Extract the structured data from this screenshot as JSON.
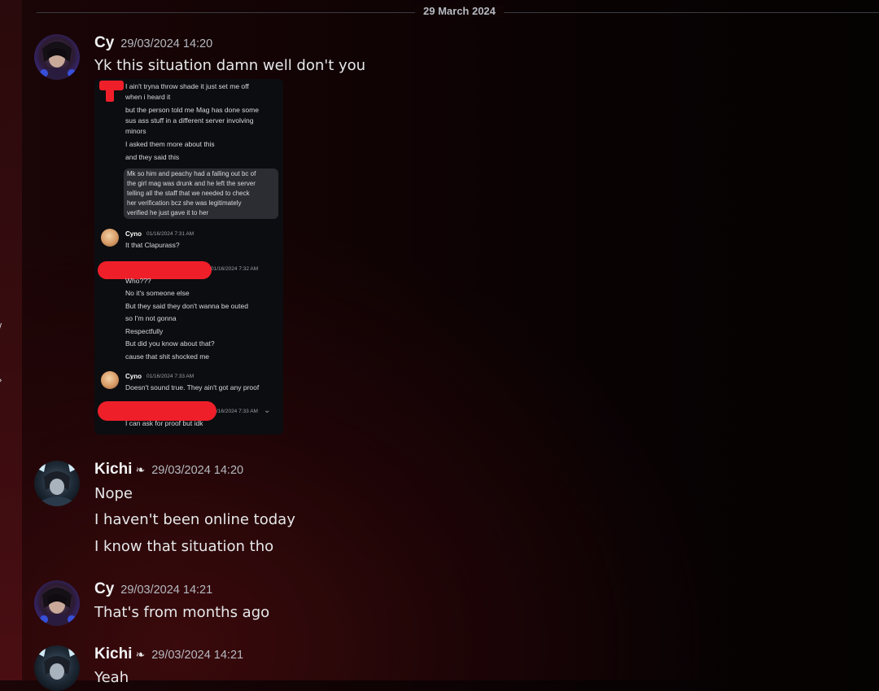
{
  "divider_date": "29 March 2024",
  "messages": [
    {
      "author": "Cy",
      "timestamp": "29/03/2024 14:20",
      "lines": [
        "Yk this situation damn well don't you"
      ]
    },
    {
      "author": "Kichi",
      "author_emoji": "❧",
      "timestamp": "29/03/2024 14:20",
      "lines": [
        "Nope",
        "I haven't been online today",
        "I know that situation tho"
      ]
    },
    {
      "author": "Cy",
      "timestamp": "29/03/2024 14:21",
      "lines": [
        "That's from months ago"
      ]
    },
    {
      "author": "Kichi",
      "author_emoji": "❧",
      "timestamp": "29/03/2024 14:21",
      "lines": [
        "Yeah"
      ]
    }
  ],
  "attachment": {
    "lines_top": [
      "I ain't tryna throw shade it just set me off",
      "when i heard it",
      "but the person told me Mag has done some",
      "sus ass stuff in a different server involving",
      "minors",
      "I asked them more about this",
      "and they said this"
    ],
    "quote_lines": [
      "Mk so him and peachy had a falling out bc of",
      "the girl mag was drunk and he left the server",
      "telling all the staff that we needed to check",
      "her verification bcz she was legitimately",
      "verified he just gave it to her"
    ],
    "cyno_name_1": "Cyno",
    "cyno_time_1": "01/16/2024 7:31 AM",
    "cyno_msg_1": "It that Clapurass?",
    "redacted_time_1": "01/16/2024 7:32 AM",
    "lines_mid": [
      "Who???",
      "No it's someone else",
      "But they said they don't wanna be outed",
      "so I'm not gonna",
      "Respectfully",
      "But did you know about that?",
      "cause that shit shocked me"
    ],
    "cyno_name_2": "Cyno",
    "cyno_time_2": "01/16/2024 7:33 AM",
    "cyno_msg_2": "Doesn't sound true. They ain't got any proof",
    "redacted_time_2": "/16/2024 7:33 AM",
    "last_line": "I can ask for proof but idk"
  },
  "colors": {
    "accent_red": "#ef1f2a",
    "text": "#e6e8ea",
    "muted": "#b5bac1"
  }
}
